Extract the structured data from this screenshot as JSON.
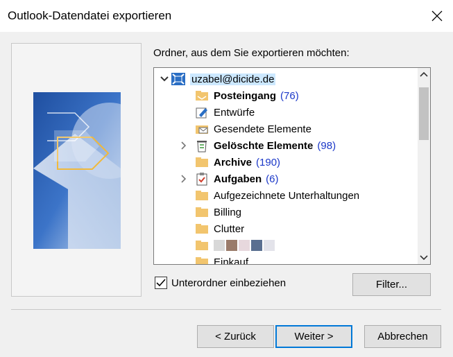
{
  "window": {
    "title": "Outlook-Datendatei exportieren"
  },
  "folder_label": "Ordner, aus dem Sie exportieren möchten:",
  "tree": {
    "account": "uzabel@dicide.de",
    "items": [
      {
        "label": "Posteingang",
        "count": "(76)",
        "bold": true,
        "icon": "inbox-folder-icon"
      },
      {
        "label": "Entwürfe",
        "count": "",
        "bold": false,
        "icon": "drafts-folder-icon"
      },
      {
        "label": "Gesendete Elemente",
        "count": "",
        "bold": false,
        "icon": "sent-folder-icon"
      },
      {
        "label": "Gelöschte Elemente",
        "count": "(98)",
        "bold": true,
        "icon": "trash-icon"
      },
      {
        "label": "Archive",
        "count": "(190)",
        "bold": true,
        "icon": "folder-icon"
      },
      {
        "label": "Aufgaben",
        "count": "(6)",
        "bold": true,
        "icon": "tasks-icon"
      },
      {
        "label": "Aufgezeichnete Unterhaltungen",
        "count": "",
        "bold": false,
        "icon": "folder-icon"
      },
      {
        "label": "Billing",
        "count": "",
        "bold": false,
        "icon": "folder-icon"
      },
      {
        "label": "Clutter",
        "count": "",
        "bold": false,
        "icon": "folder-icon"
      },
      {
        "label": "",
        "count": "",
        "bold": false,
        "icon": "folder-icon"
      },
      {
        "label": "Einkauf",
        "count": "",
        "bold": false,
        "icon": "folder-icon"
      }
    ]
  },
  "include_subfolders": {
    "label": "Unterordner einbeziehen",
    "checked": true
  },
  "buttons": {
    "filter": "Filter...",
    "back": "< Zurück",
    "next": "Weiter >",
    "cancel": "Abbrechen"
  },
  "colors": {
    "accent": "#0078d7",
    "count": "#1a37c8",
    "selection": "#cce8ff",
    "folder": "#f2c56e"
  }
}
